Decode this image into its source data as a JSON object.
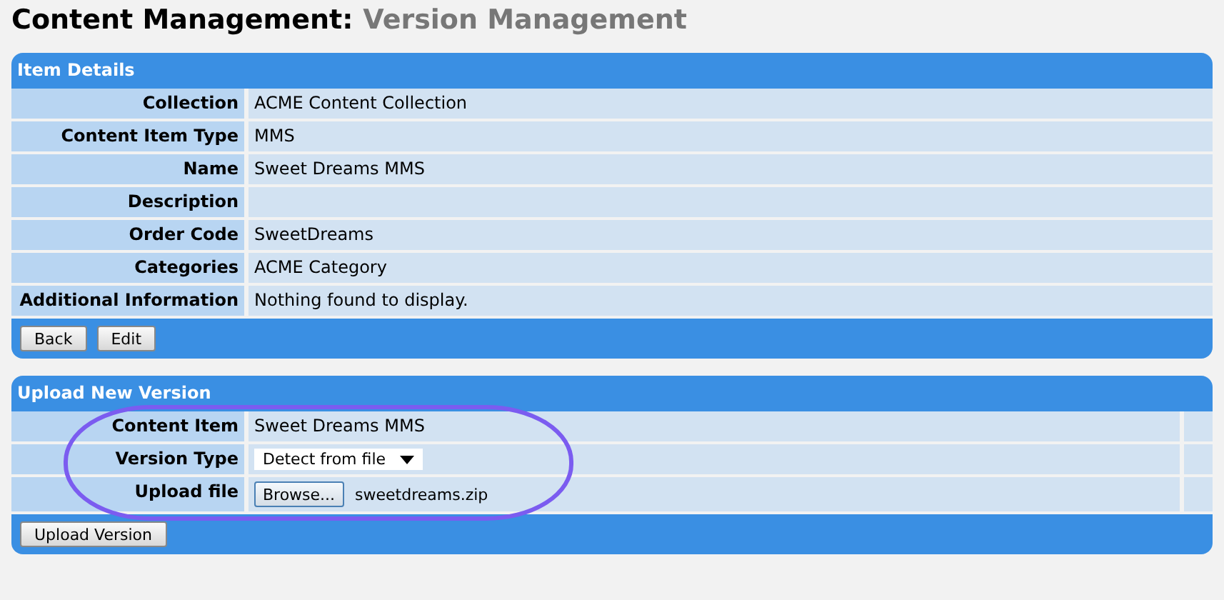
{
  "page_title": {
    "section": "Content Management:",
    "subsection": "Version Management"
  },
  "item_details": {
    "title": "Item Details",
    "rows": [
      {
        "label": "Collection",
        "value": "ACME Content Collection"
      },
      {
        "label": "Content Item Type",
        "value": "MMS"
      },
      {
        "label": "Name",
        "value": "Sweet Dreams MMS"
      },
      {
        "label": "Description"
      },
      {
        "label": "Order Code",
        "value": "SweetDreams"
      },
      {
        "label": "Categories",
        "value": "ACME Category"
      },
      {
        "label": "Additional Information",
        "value": "Nothing found to display."
      }
    ],
    "buttons": [
      "Back",
      "Edit"
    ]
  },
  "upload": {
    "title": "Upload New Version",
    "rows": [
      {
        "kind": "text",
        "label": "Content Item",
        "value": "Sweet Dreams MMS"
      },
      {
        "kind": "select",
        "label": "Version Type",
        "value": "Detect from file"
      },
      {
        "kind": "file",
        "label": "Upload file",
        "button": "Browse...",
        "value": "sweetdreams.zip"
      }
    ],
    "buttons": [
      "Upload Version"
    ]
  }
}
